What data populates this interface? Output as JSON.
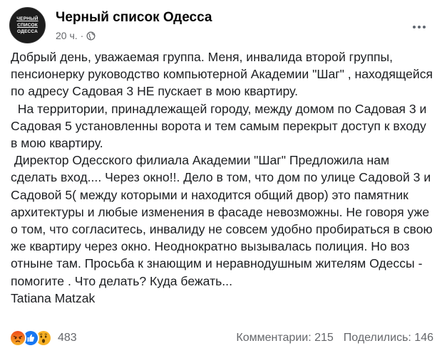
{
  "page": {
    "name": "Черный список Одесса",
    "avatar_text": [
      "ЧЕРНЫЙ",
      "СПИСОК",
      "ОДЕССА"
    ],
    "time": "20 ч.",
    "audience_icon": "globe-icon"
  },
  "post": {
    "paragraphs": [
      "Добрый день, уважаемая группа. Меня, инвалида второй группы, пенсионерку руководство компьютерной Академии \"Шаг\" , находящейся по адресу Садовая 3 НЕ пускает в мою квартиру.",
      "  На территории, принадлежащей городу, между домом по Садовая 3 и Садовая 5 установленны ворота и тем самым перекрыт доступ к входу в мою квартиру.",
      " Директор Одесского филиала Академии \"Шаг\" Предложила нам сделать вход.... Через окно!!. Дело в том, что дом по улице Садовой 3 и Садовой 5( между которыми и находится общий двор) это памятник архитектуры и любые изменения в фасаде невозможны. Не говоря уже о том, что согласитесь, инвалиду не совсем удобно пробираться в свою же квартиру через окно. Неоднократно вызывалась полиция. Но воз отныне там. Просьба к знающим и неравнодушным жителям Одессы - помогите . Что делать? Куда бежать...",
      "Tatiana Matzak"
    ]
  },
  "footer": {
    "reaction_icons": [
      "angry-icon",
      "like-icon",
      "wow-icon"
    ],
    "reaction_count": "483",
    "comments": "Комментарии: 215",
    "shares": "Поделились: 146"
  },
  "colors": {
    "text": "#1c1e21",
    "muted": "#65676b",
    "like_blue": "#1877f2",
    "angry_orange": "#e9710f",
    "wow_yellow": "#f7b125"
  }
}
